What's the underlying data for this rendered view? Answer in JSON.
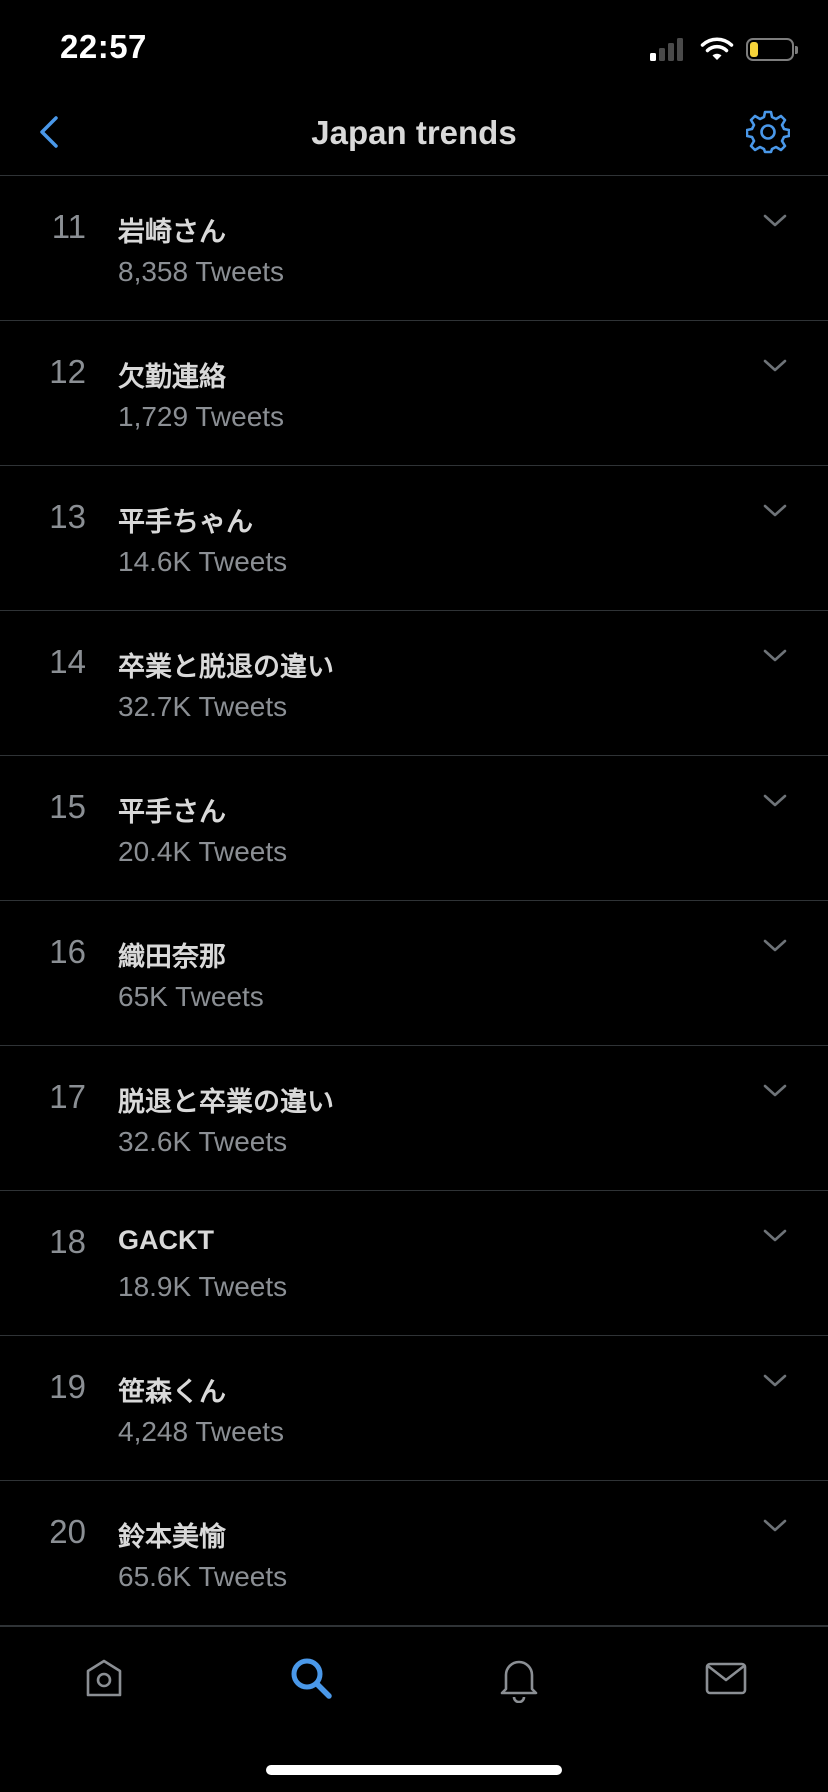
{
  "status_bar": {
    "time": "22:57",
    "signal_bars_active": 1,
    "signal_bars_total": 4,
    "battery_level": 0.2,
    "battery_color": "#f5d33a"
  },
  "header": {
    "title": "Japan trends",
    "back_icon": "chevron-left-icon",
    "settings_icon": "gear-icon",
    "accent_color": "#4a98e9"
  },
  "trends": [
    {
      "rank": "11",
      "name": "岩崎さん",
      "count": "8,358 Tweets"
    },
    {
      "rank": "12",
      "name": "欠勤連絡",
      "count": "1,729 Tweets"
    },
    {
      "rank": "13",
      "name": "平手ちゃん",
      "count": "14.6K Tweets"
    },
    {
      "rank": "14",
      "name": "卒業と脱退の違い",
      "count": "32.7K Tweets"
    },
    {
      "rank": "15",
      "name": "平手さん",
      "count": "20.4K Tweets"
    },
    {
      "rank": "16",
      "name": "織田奈那",
      "count": "65K Tweets"
    },
    {
      "rank": "17",
      "name": "脱退と卒業の違い",
      "count": "32.6K Tweets"
    },
    {
      "rank": "18",
      "name": "GACKT",
      "count": "18.9K Tweets"
    },
    {
      "rank": "19",
      "name": "笹森くん",
      "count": "4,248 Tweets"
    },
    {
      "rank": "20",
      "name": "鈴本美愉",
      "count": "65.6K Tweets"
    }
  ],
  "tab_bar": {
    "tabs": [
      {
        "icon": "home-icon",
        "active": false
      },
      {
        "icon": "search-icon",
        "active": true
      },
      {
        "icon": "bell-icon",
        "active": false
      },
      {
        "icon": "mail-icon",
        "active": false
      }
    ],
    "active_color": "#4a98e9",
    "inactive_color": "#8b8f94"
  }
}
